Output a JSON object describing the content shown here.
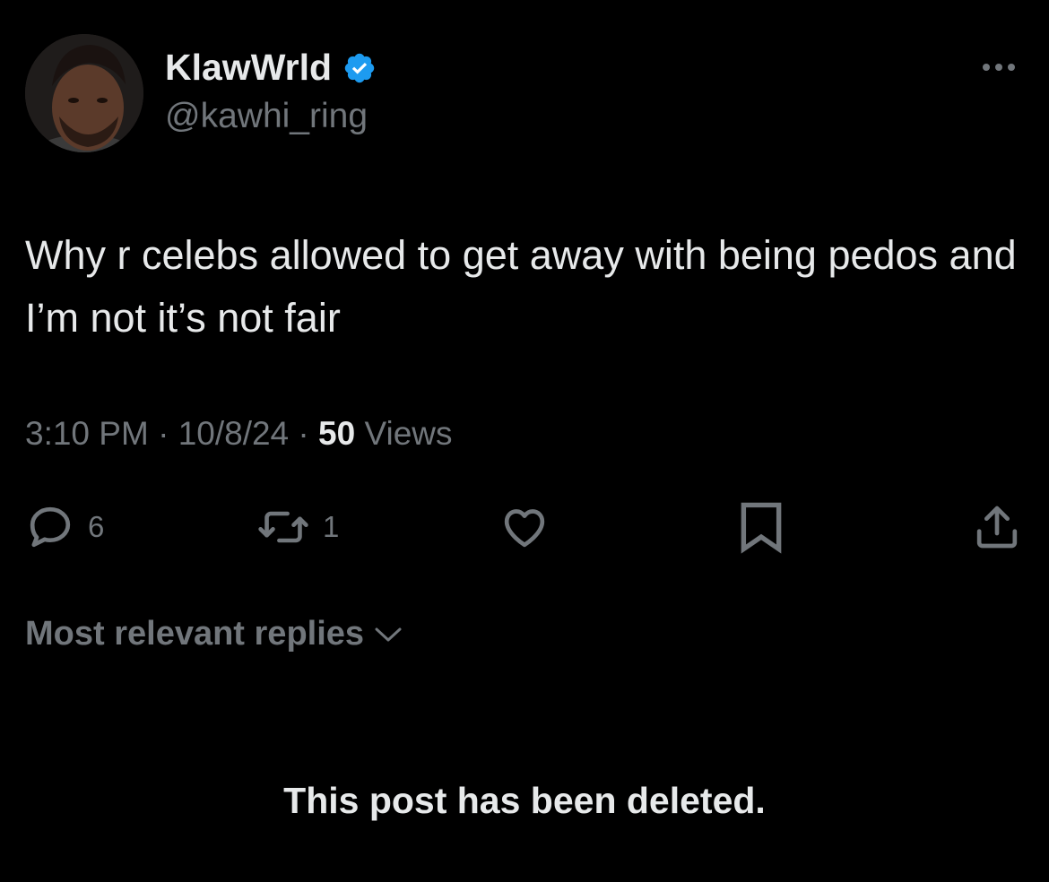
{
  "author": {
    "display_name": "KlawWrld",
    "handle": "@kawhi_ring",
    "verified": true,
    "avatar_icon": "profile-photo"
  },
  "post": {
    "text": "Why r celebs allowed to get away with being pedos and I’m not it’s not fair",
    "time": "3:10 PM",
    "date": "10/8/24",
    "separator": " · ",
    "views_count": "50",
    "views_label": " Views"
  },
  "actions": {
    "reply": {
      "icon": "reply-icon",
      "count": "6"
    },
    "repost": {
      "icon": "repost-icon",
      "count": "1"
    },
    "like": {
      "icon": "heart-icon",
      "count": ""
    },
    "bookmark": {
      "icon": "bookmark-icon"
    },
    "share": {
      "icon": "share-icon"
    }
  },
  "replies": {
    "sort_label": "Most relevant replies"
  },
  "deleted_notice": "This post has been deleted.",
  "colors": {
    "background": "#000000",
    "text_primary": "#e7e9ea",
    "text_secondary": "#71767b",
    "verified_badge": "#1d9bf0"
  }
}
